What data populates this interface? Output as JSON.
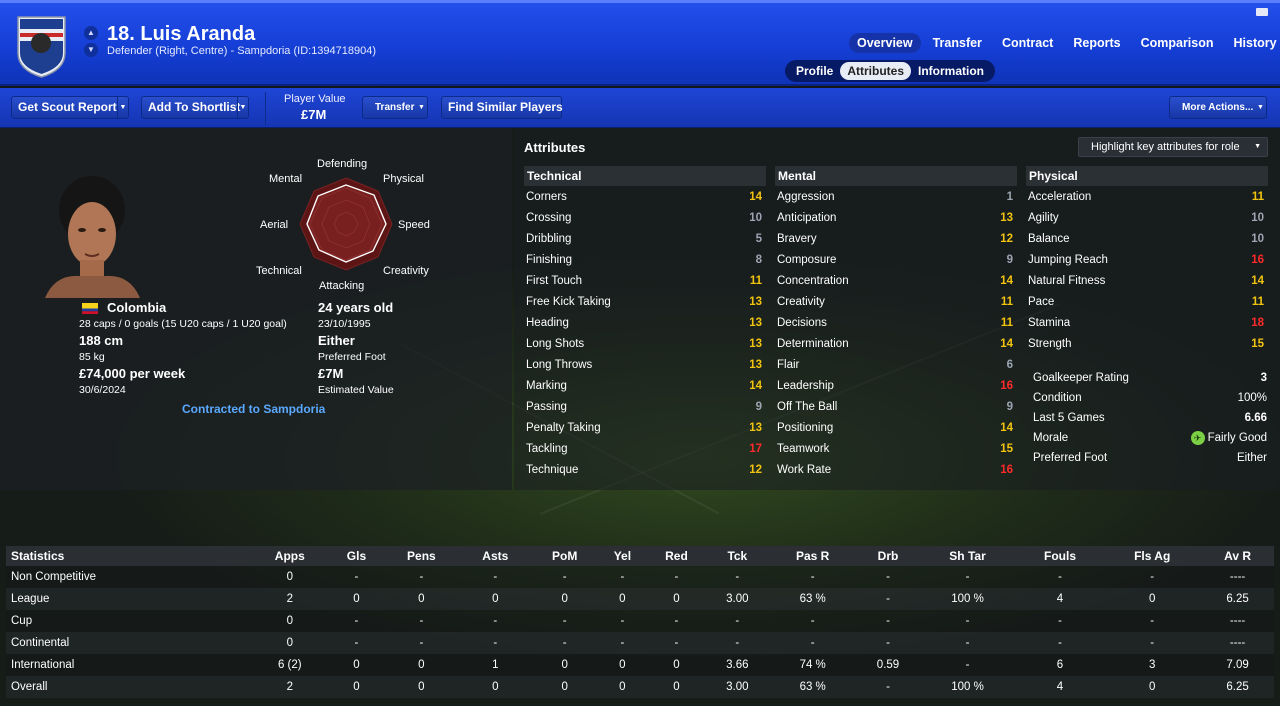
{
  "header": {
    "name": "18. Luis Aranda",
    "subtitle": "Defender (Right, Centre) - Sampdoria (ID:1394718904)",
    "nav": [
      "Overview",
      "Transfer",
      "Contract",
      "Reports",
      "Comparison",
      "History"
    ],
    "subnav": [
      "Profile",
      "Attributes",
      "Information"
    ],
    "colors": {
      "header": "#1a44e0",
      "accent": "#5aa9ff"
    }
  },
  "toolbar": {
    "scout": "Get Scout Report",
    "shortlist": "Add To Shortlist",
    "pv_label": "Player Value",
    "pv_value": "£7M",
    "transfer": "Transfer",
    "similar": "Find Similar Players",
    "more": "More Actions..."
  },
  "profile": {
    "nation": "Colombia",
    "caps": "28 caps / 0 goals (15 U20 caps / 1 U20 goal)",
    "age": "24 years old",
    "dob": "23/10/1995",
    "height": "188 cm",
    "weight": "85 kg",
    "foot": "Either",
    "foot_label": "Preferred Foot",
    "wage": "£74,000 per week",
    "contract_end": "30/6/2024",
    "value": "£7M",
    "value_label": "Estimated Value",
    "contracted": "Contracted to Sampdoria"
  },
  "radar": {
    "labels": {
      "top": "Defending",
      "tr": "Physical",
      "r": "Speed",
      "br": "Creativity",
      "b": "Attacking",
      "bl": "Technical",
      "l": "Aerial",
      "tl": "Mental"
    }
  },
  "attributes": {
    "title": "Attributes",
    "highlight": "Highlight key attributes for role",
    "technical": {
      "title": "Technical",
      "items": [
        {
          "n": "Corners",
          "v": "14",
          "c": "good"
        },
        {
          "n": "Crossing",
          "v": "10",
          "c": "low"
        },
        {
          "n": "Dribbling",
          "v": "5",
          "c": "low"
        },
        {
          "n": "Finishing",
          "v": "8",
          "c": "low"
        },
        {
          "n": "First Touch",
          "v": "11",
          "c": "good"
        },
        {
          "n": "Free Kick Taking",
          "v": "13",
          "c": "good"
        },
        {
          "n": "Heading",
          "v": "13",
          "c": "good"
        },
        {
          "n": "Long Shots",
          "v": "13",
          "c": "good"
        },
        {
          "n": "Long Throws",
          "v": "13",
          "c": "good"
        },
        {
          "n": "Marking",
          "v": "14",
          "c": "good"
        },
        {
          "n": "Passing",
          "v": "9",
          "c": "low"
        },
        {
          "n": "Penalty Taking",
          "v": "13",
          "c": "good"
        },
        {
          "n": "Tackling",
          "v": "17",
          "c": "bad"
        },
        {
          "n": "Technique",
          "v": "12",
          "c": "good"
        }
      ]
    },
    "mental": {
      "title": "Mental",
      "items": [
        {
          "n": "Aggression",
          "v": "1",
          "c": "low"
        },
        {
          "n": "Anticipation",
          "v": "13",
          "c": "good"
        },
        {
          "n": "Bravery",
          "v": "12",
          "c": "good"
        },
        {
          "n": "Composure",
          "v": "9",
          "c": "low"
        },
        {
          "n": "Concentration",
          "v": "14",
          "c": "good"
        },
        {
          "n": "Creativity",
          "v": "11",
          "c": "good"
        },
        {
          "n": "Decisions",
          "v": "11",
          "c": "good"
        },
        {
          "n": "Determination",
          "v": "14",
          "c": "good"
        },
        {
          "n": "Flair",
          "v": "6",
          "c": "low"
        },
        {
          "n": "Leadership",
          "v": "16",
          "c": "bad"
        },
        {
          "n": "Off The Ball",
          "v": "9",
          "c": "low"
        },
        {
          "n": "Positioning",
          "v": "14",
          "c": "good"
        },
        {
          "n": "Teamwork",
          "v": "15",
          "c": "good"
        },
        {
          "n": "Work Rate",
          "v": "16",
          "c": "bad"
        }
      ]
    },
    "physical": {
      "title": "Physical",
      "items": [
        {
          "n": "Acceleration",
          "v": "11",
          "c": "good"
        },
        {
          "n": "Agility",
          "v": "10",
          "c": "low"
        },
        {
          "n": "Balance",
          "v": "10",
          "c": "low"
        },
        {
          "n": "Jumping Reach",
          "v": "16",
          "c": "bad"
        },
        {
          "n": "Natural Fitness",
          "v": "14",
          "c": "good"
        },
        {
          "n": "Pace",
          "v": "11",
          "c": "good"
        },
        {
          "n": "Stamina",
          "v": "18",
          "c": "bad"
        },
        {
          "n": "Strength",
          "v": "15",
          "c": "good"
        }
      ]
    },
    "extra": [
      {
        "n": "Goalkeeper Rating",
        "v": "3"
      },
      {
        "n": "Condition",
        "v": "100%"
      },
      {
        "n": "Last 5 Games",
        "v": "6.66"
      },
      {
        "n": "Morale",
        "v": "Fairly Good"
      },
      {
        "n": "Preferred Foot",
        "v": "Either"
      }
    ]
  },
  "stats": {
    "headers": [
      "Statistics",
      "Apps",
      "Gls",
      "Pens",
      "Asts",
      "PoM",
      "Yel",
      "Red",
      "Tck",
      "Pas R",
      "Drb",
      "Sh Tar",
      "Fouls",
      "Fls Ag",
      "Av R"
    ],
    "rows": [
      [
        "Non Competitive",
        "0",
        "-",
        "-",
        "-",
        "-",
        "-",
        "-",
        "-",
        "-",
        "-",
        "-",
        "-",
        "-",
        "----"
      ],
      [
        "League",
        "2",
        "0",
        "0",
        "0",
        "0",
        "0",
        "0",
        "3.00",
        "63 %",
        "-",
        "100 %",
        "4",
        "0",
        "6.25"
      ],
      [
        "Cup",
        "0",
        "-",
        "-",
        "-",
        "-",
        "-",
        "-",
        "-",
        "-",
        "-",
        "-",
        "-",
        "-",
        "----"
      ],
      [
        "Continental",
        "0",
        "-",
        "-",
        "-",
        "-",
        "-",
        "-",
        "-",
        "-",
        "-",
        "-",
        "-",
        "-",
        "----"
      ],
      [
        "International",
        "6 (2)",
        "0",
        "0",
        "1",
        "0",
        "0",
        "0",
        "3.66",
        "74 %",
        "0.59",
        "-",
        "6",
        "3",
        "7.09"
      ],
      [
        "Overall",
        "2",
        "0",
        "0",
        "0",
        "0",
        "0",
        "0",
        "3.00",
        "63 %",
        "-",
        "100 %",
        "4",
        "0",
        "6.25"
      ]
    ]
  }
}
